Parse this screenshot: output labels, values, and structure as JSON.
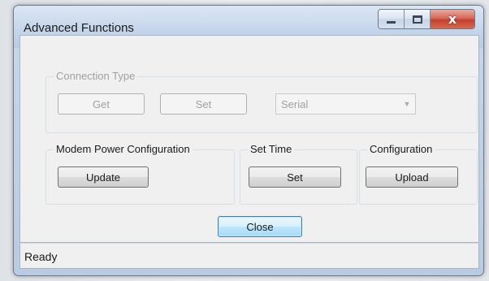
{
  "window": {
    "title": "Advanced Functions",
    "controls": {
      "minimize_icon": "minimize-icon",
      "maximize_icon": "maximize-icon",
      "close_glyph": "x"
    }
  },
  "connection_type": {
    "label": "Connection Type",
    "get_label": "Get",
    "set_label": "Set",
    "combo_value": "Serial",
    "enabled": false
  },
  "modem_power": {
    "label": "Modem Power Configuration",
    "update_label": "Update"
  },
  "set_time": {
    "label": "Set Time",
    "set_label": "Set"
  },
  "configuration": {
    "label": "Configuration",
    "upload_label": "Upload"
  },
  "close_label": "Close",
  "status": {
    "text": "Ready"
  },
  "colors": {
    "accent_focus": "#3c7fb1",
    "close_button": "#c3412f",
    "disabled_text": "#a0a0a0"
  }
}
